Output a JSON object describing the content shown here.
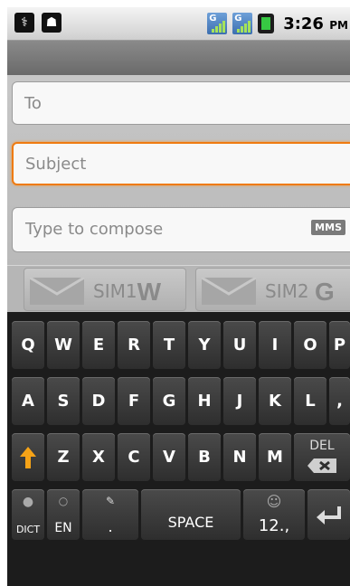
{
  "status_bar": {
    "time": "3:26",
    "ampm": "PM",
    "signal1_label": "G",
    "signal2_label": "G"
  },
  "compose": {
    "to_placeholder": "To",
    "subject_placeholder": "Subject",
    "message_placeholder": "Type to compose",
    "mms_badge": "MMS"
  },
  "sim_bar": {
    "sim1_label": "SIM1",
    "sim1_letter": "W",
    "sim2_label": "SIM2",
    "sim2_letter": "G"
  },
  "keyboard": {
    "row1": [
      "Q",
      "W",
      "E",
      "R",
      "T",
      "Y",
      "U",
      "I",
      "O",
      "P"
    ],
    "row2": [
      "A",
      "S",
      "D",
      "F",
      "G",
      "H",
      "J",
      "K",
      "L",
      ","
    ],
    "row3": [
      "Z",
      "X",
      "C",
      "V",
      "B",
      "N",
      "M"
    ],
    "del": "DEL",
    "dict": "DICT",
    "lang": "EN",
    "dot": ".",
    "space": "SPACE",
    "num": "12.,"
  },
  "colors": {
    "focus": "#ef7b11",
    "keyboard_bg": "#1c1c1c"
  }
}
